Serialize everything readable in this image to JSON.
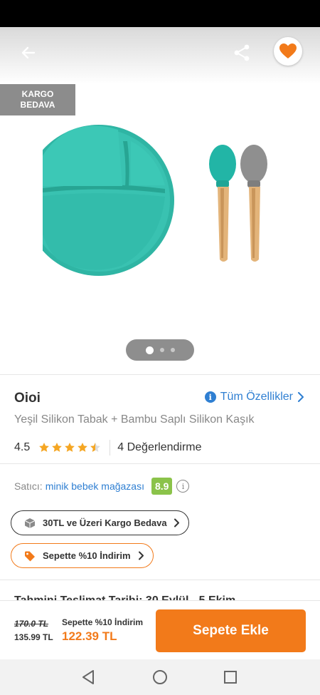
{
  "gallery": {
    "badge": "KARGO\nBEDAVA",
    "page_count": 3,
    "active_page": 1
  },
  "product": {
    "brand": "Oioi",
    "all_features_label": "Tüm Özellikler",
    "title": "Yeşil Silikon Tabak + Bambu Saplı Silikon Kaşık",
    "rating_value": "4.5",
    "rating_stars": 4.5,
    "review_count_label": "4 Değerlendirme"
  },
  "seller": {
    "label": "Satıcı:",
    "name": "minik bebek mağazası",
    "score": "8.9"
  },
  "chips": {
    "cargo": "30TL ve Üzeri Kargo Bedava",
    "discount": "Sepette %10 İndirim"
  },
  "peek_text": "Tahmini Teslimat Tarihi: 30 Eylül - 5 Ekim",
  "bottom": {
    "old_price": "170.0 TL",
    "prev_price": "135.99 TL",
    "basket_label": "Sepette %10 İndirim",
    "final_price": "122.39 TL",
    "add_button": "Sepete Ekle"
  },
  "colors": {
    "accent": "#f27a1a",
    "link": "#2f7fd2",
    "score": "#8bc34a",
    "plate": "#2fb5a4",
    "spoon_gray": "#8f8f8f"
  },
  "icons": {
    "back": "arrow-left-icon",
    "share": "share-icon",
    "favorite": "heart-icon",
    "info": "info-icon",
    "chevron": "chevron-right-icon",
    "cargo": "box-icon",
    "discount": "tag-icon",
    "nav_back": "triangle-back-icon",
    "nav_home": "circle-home-icon",
    "nav_recent": "square-recent-icon"
  }
}
